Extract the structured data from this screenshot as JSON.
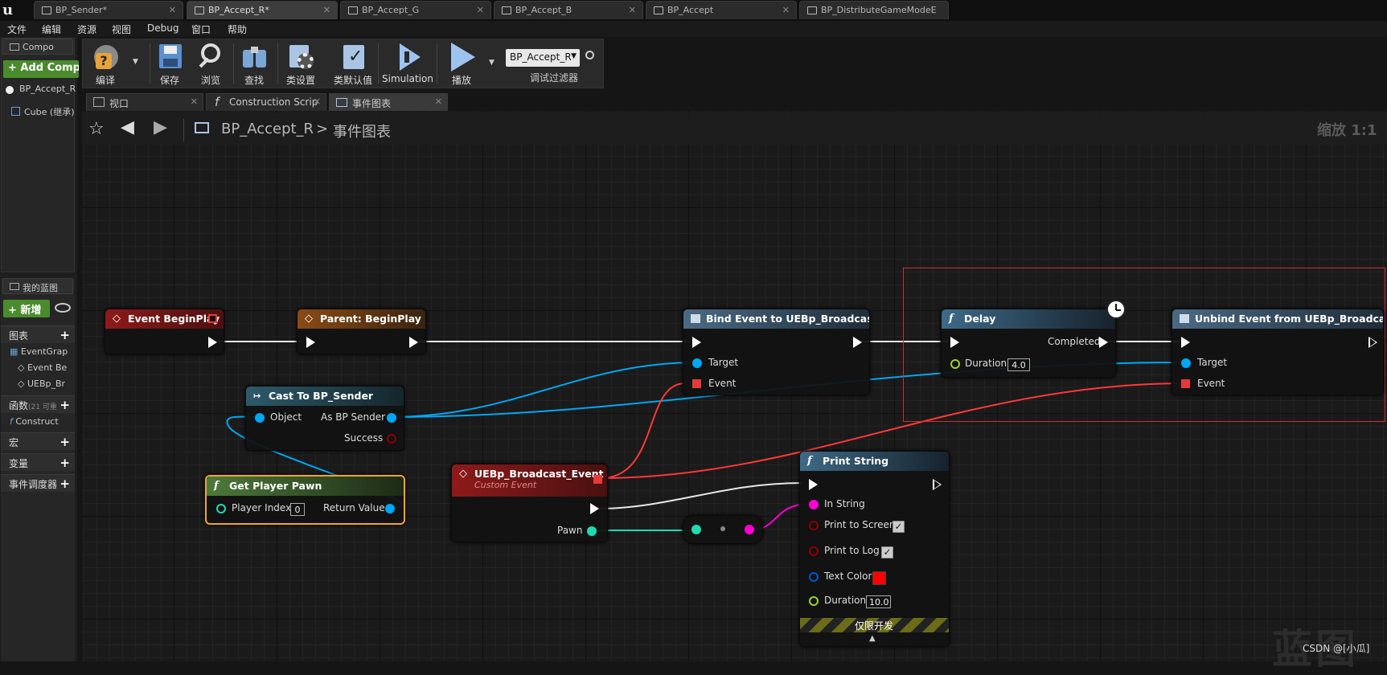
{
  "tabs": [
    {
      "label": "BP_Sender*"
    },
    {
      "label": "BP_Accept_R*"
    },
    {
      "label": "BP_Accept_G"
    },
    {
      "label": "BP_Accept_B"
    },
    {
      "label": "BP_Accept"
    },
    {
      "label": "BP_DistributeGameModeE"
    }
  ],
  "menu": [
    "文件",
    "编辑",
    "资源",
    "视图",
    "Debug",
    "窗口",
    "帮助"
  ],
  "components_panel": {
    "tab": "Compo",
    "add_button": "+ Add Compo",
    "items": [
      "BP_Accept_R",
      "Cube (继承)"
    ]
  },
  "my_blueprint": {
    "tab": "我的蓝图",
    "new_button": "+ 新增",
    "sections": {
      "graphs": "图表",
      "functions": "函数",
      "functions_count": "(21 可重",
      "macros": "宏",
      "variables": "变量",
      "dispatchers": "事件调度器"
    },
    "graph_items": [
      "EventGrap",
      "Event Be",
      "UEBp_Br"
    ],
    "function_items": [
      "Construct"
    ]
  },
  "toolbar": {
    "buttons": [
      "编译",
      "保存",
      "浏览",
      "查找",
      "类设置",
      "类默认值",
      "Simulation",
      "播放"
    ],
    "debug_select": "BP_Accept_R",
    "debug_filter": "调试过滤器"
  },
  "subtabs": [
    "视口",
    "Construction Scrip",
    "事件图表"
  ],
  "breadcrumb": {
    "root": "BP_Accept_R",
    "sep": ">",
    "current": "事件图表"
  },
  "zoom": "缩放 1:1",
  "nodes": {
    "begin_play": {
      "title": "Event BeginPlay"
    },
    "parent_begin": {
      "title": "Parent: BeginPlay"
    },
    "bind_event": {
      "title": "Bind Event to UEBp_Broadcast",
      "target": "Target",
      "event": "Event"
    },
    "delay": {
      "title": "Delay",
      "completed": "Completed",
      "duration": "Duration",
      "duration_value": "4.0"
    },
    "unbind_event": {
      "title": "Unbind Event from UEBp_Broadcast",
      "target": "Target",
      "event": "Event"
    },
    "cast": {
      "title": "Cast To BP_Sender",
      "object": "Object",
      "as": "As BP Sender",
      "success": "Success"
    },
    "get_pawn": {
      "title": "Get Player Pawn",
      "player_index": "Player Index",
      "player_index_value": "0",
      "return_value": "Return Value"
    },
    "custom_event": {
      "title": "UEBp_Broadcast_Event",
      "subtitle": "Custom Event",
      "pawn": "Pawn"
    },
    "print_string": {
      "title": "Print String",
      "in_string": "In String",
      "print_screen": "Print to Screen",
      "print_log": "Print to Log",
      "text_color": "Text Color",
      "duration": "Duration",
      "duration_value": "10.0",
      "dev_only": "仅限开发"
    }
  },
  "colors": {
    "exec": "#ffffff",
    "object": "#00a8f4",
    "delegate": "#ff3838",
    "string": "#ff00d4",
    "float": "#9cd42d",
    "bool": "#8f0000",
    "struct": "#0058c8",
    "selection": "#f5a623",
    "text_color_value": "#ff0000"
  },
  "watermark": "蓝图",
  "credit": "CSDN @[小瓜]"
}
